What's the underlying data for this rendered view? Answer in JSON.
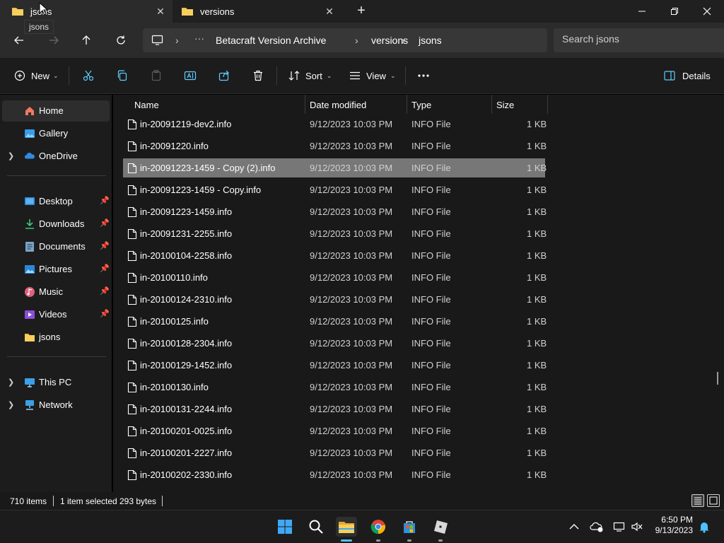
{
  "tabs": [
    {
      "label": "jsons",
      "tooltip": "jsons"
    },
    {
      "label": "versions"
    }
  ],
  "address": {
    "crumbs": [
      "Betacraft Version Archive",
      "versions",
      "jsons"
    ]
  },
  "search": {
    "placeholder": "Search jsons"
  },
  "toolbar": {
    "new_label": "New",
    "sort_label": "Sort",
    "view_label": "View",
    "details_label": "Details"
  },
  "sidebar": {
    "items": [
      {
        "label": "Home"
      },
      {
        "label": "Gallery"
      },
      {
        "label": "OneDrive"
      },
      {
        "label": "Desktop"
      },
      {
        "label": "Downloads"
      },
      {
        "label": "Documents"
      },
      {
        "label": "Pictures"
      },
      {
        "label": "Music"
      },
      {
        "label": "Videos"
      },
      {
        "label": "jsons"
      },
      {
        "label": "This PC"
      },
      {
        "label": "Network"
      }
    ]
  },
  "columns": {
    "name": "Name",
    "date": "Date modified",
    "type": "Type",
    "size": "Size"
  },
  "files": [
    {
      "name": "in-20091219-dev2.info",
      "date": "9/12/2023 10:03 PM",
      "type": "INFO File",
      "size": "1 KB"
    },
    {
      "name": "in-20091220.info",
      "date": "9/12/2023 10:03 PM",
      "type": "INFO File",
      "size": "1 KB"
    },
    {
      "name": "in-20091223-1459 - Copy (2).info",
      "date": "9/12/2023 10:03 PM",
      "type": "INFO File",
      "size": "1 KB",
      "selected": true
    },
    {
      "name": "in-20091223-1459 - Copy.info",
      "date": "9/12/2023 10:03 PM",
      "type": "INFO File",
      "size": "1 KB"
    },
    {
      "name": "in-20091223-1459.info",
      "date": "9/12/2023 10:03 PM",
      "type": "INFO File",
      "size": "1 KB"
    },
    {
      "name": "in-20091231-2255.info",
      "date": "9/12/2023 10:03 PM",
      "type": "INFO File",
      "size": "1 KB"
    },
    {
      "name": "in-20100104-2258.info",
      "date": "9/12/2023 10:03 PM",
      "type": "INFO File",
      "size": "1 KB"
    },
    {
      "name": "in-20100110.info",
      "date": "9/12/2023 10:03 PM",
      "type": "INFO File",
      "size": "1 KB"
    },
    {
      "name": "in-20100124-2310.info",
      "date": "9/12/2023 10:03 PM",
      "type": "INFO File",
      "size": "1 KB"
    },
    {
      "name": "in-20100125.info",
      "date": "9/12/2023 10:03 PM",
      "type": "INFO File",
      "size": "1 KB"
    },
    {
      "name": "in-20100128-2304.info",
      "date": "9/12/2023 10:03 PM",
      "type": "INFO File",
      "size": "1 KB"
    },
    {
      "name": "in-20100129-1452.info",
      "date": "9/12/2023 10:03 PM",
      "type": "INFO File",
      "size": "1 KB"
    },
    {
      "name": "in-20100130.info",
      "date": "9/12/2023 10:03 PM",
      "type": "INFO File",
      "size": "1 KB"
    },
    {
      "name": "in-20100131-2244.info",
      "date": "9/12/2023 10:03 PM",
      "type": "INFO File",
      "size": "1 KB"
    },
    {
      "name": "in-20100201-0025.info",
      "date": "9/12/2023 10:03 PM",
      "type": "INFO File",
      "size": "1 KB"
    },
    {
      "name": "in-20100201-2227.info",
      "date": "9/12/2023 10:03 PM",
      "type": "INFO File",
      "size": "1 KB"
    },
    {
      "name": "in-20100202-2330.info",
      "date": "9/12/2023 10:03 PM",
      "type": "INFO File",
      "size": "1 KB"
    }
  ],
  "status": {
    "item_count": "710 items",
    "selection": "1 item selected",
    "selection_size": "293 bytes"
  },
  "clock": {
    "time": "6:50 PM",
    "date": "9/13/2023"
  },
  "colors": {
    "folder": "#f0c04a",
    "accent": "#4cc2ff",
    "selected_row": "#777777"
  },
  "icons": {
    "back": "back-arrow-icon",
    "forward": "forward-arrow-icon",
    "up": "up-arrow-icon",
    "refresh": "refresh-icon",
    "computer": "computer-icon"
  }
}
